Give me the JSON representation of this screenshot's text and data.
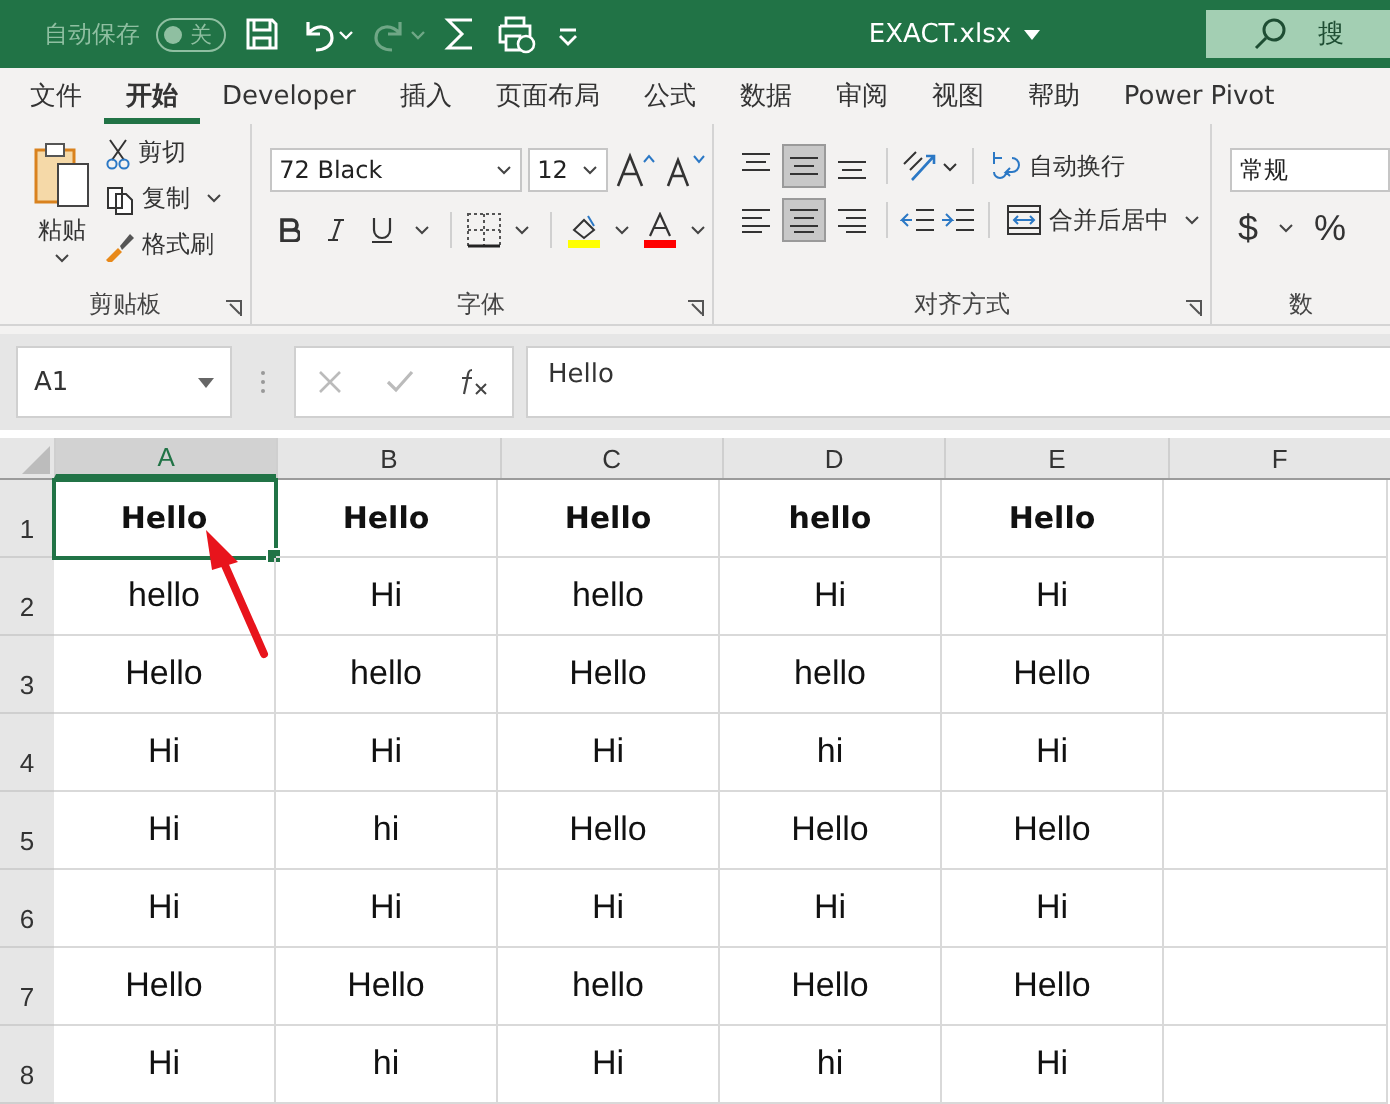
{
  "title_bar": {
    "autosave_label": "自动保存",
    "autosave_toggle": {
      "label": "关",
      "on": false
    },
    "filename": "EXACT.xlsx",
    "search_placeholder": "搜"
  },
  "tabs": [
    {
      "label": "文件",
      "selected": false
    },
    {
      "label": "开始",
      "selected": true
    },
    {
      "label": "Developer",
      "selected": false
    },
    {
      "label": "插入",
      "selected": false
    },
    {
      "label": "页面布局",
      "selected": false
    },
    {
      "label": "公式",
      "selected": false
    },
    {
      "label": "数据",
      "selected": false
    },
    {
      "label": "审阅",
      "selected": false
    },
    {
      "label": "视图",
      "selected": false
    },
    {
      "label": "帮助",
      "selected": false
    },
    {
      "label": "Power Pivot",
      "selected": false
    }
  ],
  "ribbon": {
    "clipboard": {
      "paste": "粘贴",
      "cut": "剪切",
      "copy": "复制",
      "format_painter": "格式刷",
      "label": "剪贴板"
    },
    "font": {
      "font_name": "72 Black",
      "font_size": "12",
      "label": "字体"
    },
    "alignment": {
      "vertical": [
        {
          "selected": false
        },
        {
          "selected": true
        },
        {
          "selected": false
        }
      ],
      "horizontal": [
        {
          "selected": false
        },
        {
          "selected": true
        },
        {
          "selected": false
        }
      ],
      "wrap_text": "自动换行",
      "merge_center": "合并后居中",
      "label": "对齐方式"
    },
    "number": {
      "format": "常规",
      "currency": "$",
      "percent": "%",
      "label": "数"
    }
  },
  "formula_bar": {
    "name_box": "A1",
    "formula": "Hello"
  },
  "sheet": {
    "columns": [
      {
        "label": "A",
        "selected": true
      },
      {
        "label": "B",
        "selected": false
      },
      {
        "label": "C",
        "selected": false
      },
      {
        "label": "D",
        "selected": false
      },
      {
        "label": "E",
        "selected": false
      },
      {
        "label": "F",
        "selected": false
      }
    ],
    "rows": [
      {
        "number": "1",
        "bold": true,
        "cells": [
          {
            "text": "Hello",
            "selected": true
          },
          {
            "text": "Hello",
            "selected": false
          },
          {
            "text": "Hello",
            "selected": false
          },
          {
            "text": "hello",
            "selected": false
          },
          {
            "text": "Hello",
            "selected": false
          }
        ]
      },
      {
        "number": "2",
        "bold": false,
        "cells": [
          {
            "text": "hello",
            "selected": false
          },
          {
            "text": "Hi",
            "selected": false
          },
          {
            "text": "hello",
            "selected": false
          },
          {
            "text": "Hi",
            "selected": false
          },
          {
            "text": "Hi",
            "selected": false
          }
        ]
      },
      {
        "number": "3",
        "bold": false,
        "cells": [
          {
            "text": "Hello",
            "selected": false
          },
          {
            "text": "hello",
            "selected": false
          },
          {
            "text": "Hello",
            "selected": false
          },
          {
            "text": "hello",
            "selected": false
          },
          {
            "text": "Hello",
            "selected": false
          }
        ]
      },
      {
        "number": "4",
        "bold": false,
        "cells": [
          {
            "text": "Hi",
            "selected": false
          },
          {
            "text": "Hi",
            "selected": false
          },
          {
            "text": "Hi",
            "selected": false
          },
          {
            "text": "hi",
            "selected": false
          },
          {
            "text": "Hi",
            "selected": false
          }
        ]
      },
      {
        "number": "5",
        "bold": false,
        "cells": [
          {
            "text": "Hi",
            "selected": false
          },
          {
            "text": "hi",
            "selected": false
          },
          {
            "text": "Hello",
            "selected": false
          },
          {
            "text": "Hello",
            "selected": false
          },
          {
            "text": "Hello",
            "selected": false
          }
        ]
      },
      {
        "number": "6",
        "bold": false,
        "cells": [
          {
            "text": "Hi",
            "selected": false
          },
          {
            "text": "Hi",
            "selected": false
          },
          {
            "text": "Hi",
            "selected": false
          },
          {
            "text": "Hi",
            "selected": false
          },
          {
            "text": "Hi",
            "selected": false
          }
        ]
      },
      {
        "number": "7",
        "bold": false,
        "cells": [
          {
            "text": "Hello",
            "selected": false
          },
          {
            "text": "Hello",
            "selected": false
          },
          {
            "text": "hello",
            "selected": false
          },
          {
            "text": "Hello",
            "selected": false
          },
          {
            "text": "Hello",
            "selected": false
          }
        ]
      },
      {
        "number": "8",
        "bold": false,
        "cells": [
          {
            "text": "Hi",
            "selected": false
          },
          {
            "text": "hi",
            "selected": false
          },
          {
            "text": "Hi",
            "selected": false
          },
          {
            "text": "hi",
            "selected": false
          },
          {
            "text": "Hi",
            "selected": false
          }
        ]
      }
    ]
  }
}
